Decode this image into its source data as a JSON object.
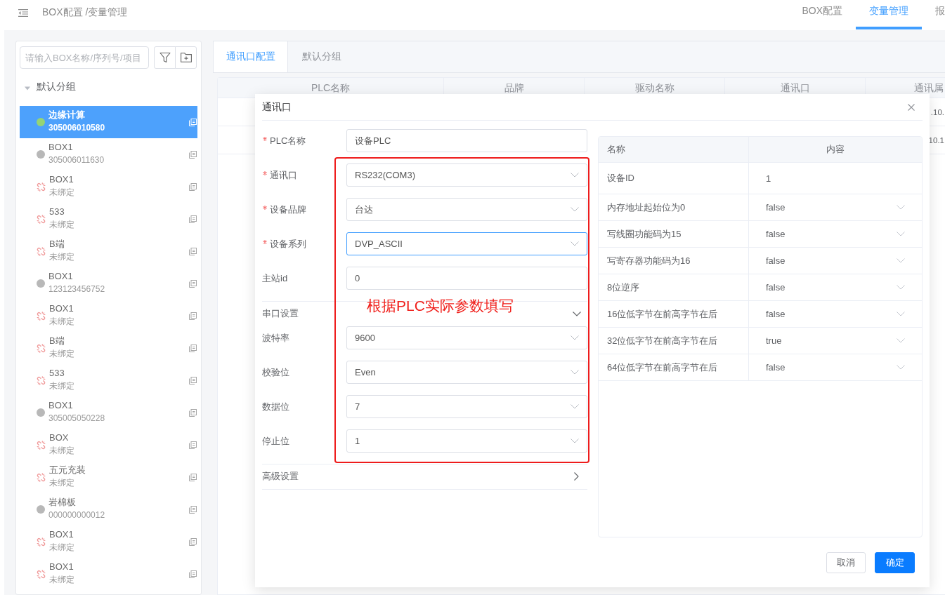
{
  "header": {
    "breadcrumb": "BOX配置 /变量管理",
    "nav_tabs": [
      {
        "label": "BOX配置",
        "selected": false
      },
      {
        "label": "变量管理",
        "selected": true
      },
      {
        "label": "报",
        "selected": false
      }
    ]
  },
  "sidebar": {
    "search": {
      "placeholder": "请输入BOX名称/序列号/项目"
    },
    "group": {
      "label": "默认分组",
      "expanded": true
    },
    "items": [
      {
        "name": "边缘计算",
        "subtitle": "305006010580",
        "kind": "dot",
        "color": "#95d475",
        "selected": true
      },
      {
        "name": "BOX1",
        "subtitle": "305006011630",
        "kind": "dot",
        "color": "#b8b8b8",
        "selected": false
      },
      {
        "name": "BOX1",
        "subtitle": "未绑定",
        "kind": "unlinked",
        "selected": false
      },
      {
        "name": "533",
        "subtitle": "未绑定",
        "kind": "unlinked",
        "selected": false
      },
      {
        "name": "B端",
        "subtitle": "未绑定",
        "kind": "unlinked",
        "selected": false
      },
      {
        "name": "BOX1",
        "subtitle": "123123456752",
        "kind": "dot",
        "color": "#b8b8b8",
        "selected": false
      },
      {
        "name": "BOX1",
        "subtitle": "未绑定",
        "kind": "unlinked",
        "selected": false
      },
      {
        "name": "B端",
        "subtitle": "未绑定",
        "kind": "unlinked",
        "selected": false
      },
      {
        "name": "533",
        "subtitle": "未绑定",
        "kind": "unlinked",
        "selected": false
      },
      {
        "name": "BOX1",
        "subtitle": "305005050228",
        "kind": "dot",
        "color": "#b8b8b8",
        "selected": false
      },
      {
        "name": "BOX",
        "subtitle": "未绑定",
        "kind": "unlinked",
        "selected": false
      },
      {
        "name": "五元充装",
        "subtitle": "未绑定",
        "kind": "unlinked",
        "selected": false
      },
      {
        "name": "岩棉板",
        "subtitle": "000000000012",
        "kind": "dot",
        "color": "#b8b8b8",
        "selected": false
      },
      {
        "name": "BOX1",
        "subtitle": "未绑定",
        "kind": "unlinked",
        "selected": false
      },
      {
        "name": "BOX1",
        "subtitle": "未绑定",
        "kind": "unlinked",
        "selected": false
      }
    ]
  },
  "main": {
    "tabs": [
      {
        "label": "通讯口配置",
        "selected": true
      },
      {
        "label": "默认分组",
        "selected": false
      }
    ],
    "table": {
      "columns": [
        "PLC名称",
        "品牌",
        "驱动名称",
        "通讯口",
        "通讯属"
      ],
      "rows": [
        {
          "column_5": ".10."
        },
        {
          "column_5": "10.1"
        }
      ]
    }
  },
  "dialog": {
    "title": "通讯口",
    "fields": [
      {
        "label": "PLC名称",
        "required": true,
        "kind": "input",
        "value": "设备PLC",
        "focused": false
      },
      {
        "label": "通讯口",
        "required": true,
        "kind": "select",
        "value": "RS232(COM3)",
        "focused": false
      },
      {
        "label": "设备品牌",
        "required": true,
        "kind": "select",
        "value": "台达",
        "focused": false
      },
      {
        "label": "设备系列",
        "required": true,
        "kind": "select",
        "value": "DVP_ASCII",
        "focused": true
      },
      {
        "label": "主站id",
        "required": false,
        "kind": "input",
        "value": "0",
        "focused": false
      }
    ],
    "sections": [
      {
        "title": "串口设置",
        "expanded": true,
        "fields": [
          {
            "label": "波特率",
            "required": false,
            "kind": "select",
            "value": "9600",
            "focused": false
          },
          {
            "label": "校验位",
            "required": false,
            "kind": "select",
            "value": "Even",
            "focused": false
          },
          {
            "label": "数据位",
            "required": false,
            "kind": "select",
            "value": "7",
            "focused": false
          },
          {
            "label": "停止位",
            "required": false,
            "kind": "select",
            "value": "1",
            "focused": false
          }
        ]
      },
      {
        "title": "高级设置",
        "expanded": false
      }
    ],
    "params": {
      "columns": [
        "名称",
        "内容"
      ],
      "rows": [
        {
          "name": "设备ID",
          "kind": "input",
          "value": "1"
        },
        {
          "name": "内存地址起始位为0",
          "kind": "select",
          "value": "false"
        },
        {
          "name": "写线圈功能码为15",
          "kind": "select",
          "value": "false"
        },
        {
          "name": "写寄存器功能码为16",
          "kind": "select",
          "value": "false"
        },
        {
          "name": "8位逆序",
          "kind": "select",
          "value": "false"
        },
        {
          "name": "16位低字节在前高字节在后",
          "kind": "select",
          "value": "false"
        },
        {
          "name": "32位低字节在前高字节在后",
          "kind": "select",
          "value": "true"
        },
        {
          "name": "64位低字节在前高字节在后",
          "kind": "select",
          "value": "false"
        }
      ]
    },
    "annotation": {
      "text": "根据PLC实际参数填写"
    },
    "buttons": [
      {
        "label": "取消",
        "kind": "secondary"
      },
      {
        "label": "确定",
        "kind": "primary"
      }
    ]
  }
}
